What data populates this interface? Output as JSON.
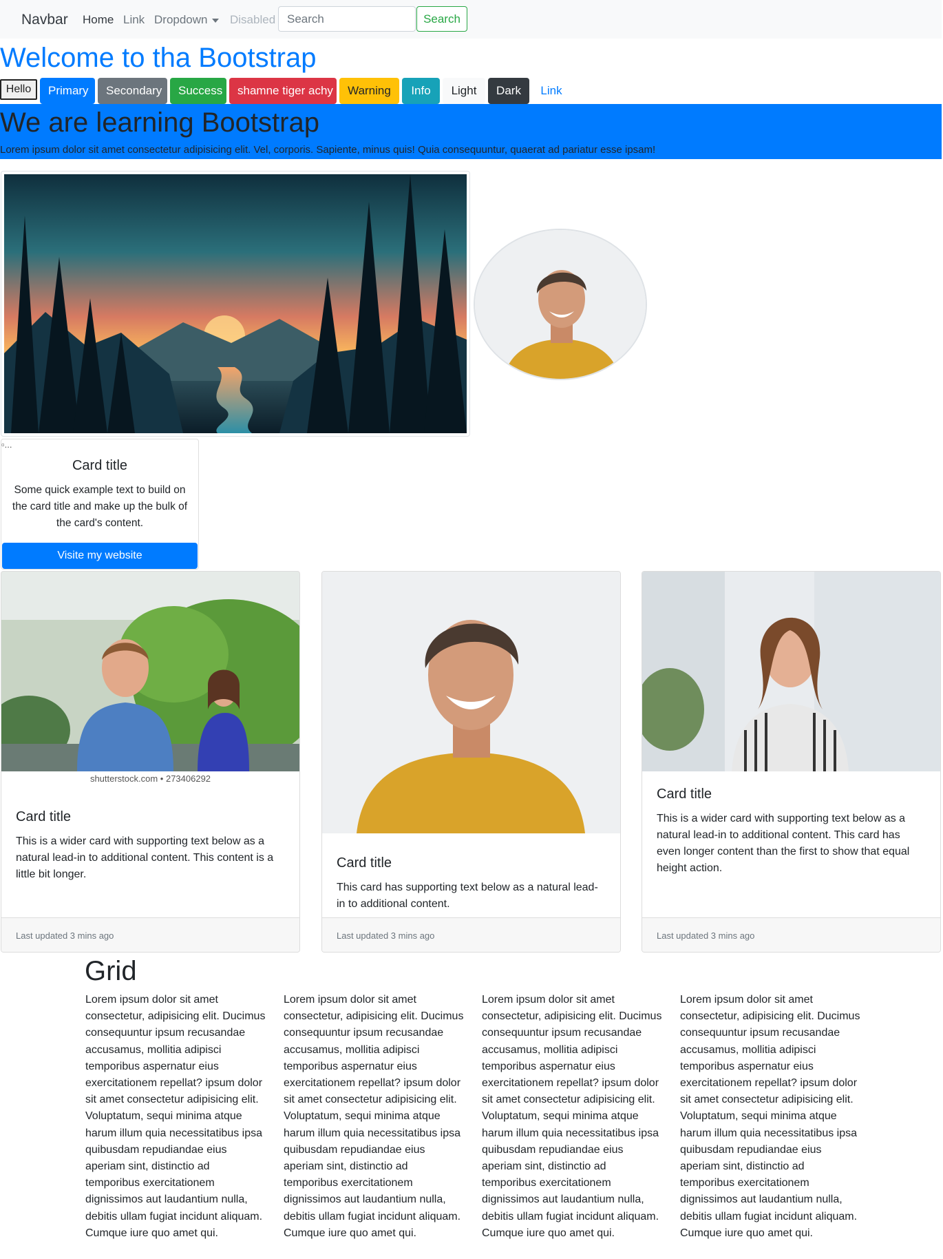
{
  "navbar": {
    "brand": "Navbar",
    "links": [
      "Home",
      "Link",
      "Dropdown",
      "Disabled"
    ],
    "search_placeholder": "Search",
    "search_button": "Search"
  },
  "welcome_heading": "Welcome to tha Bootstrap",
  "buttons": [
    "Hello",
    "Primary",
    "Secondary",
    "Success",
    "shamne tiger achy",
    "Warning",
    "Info",
    "Light",
    "Dark",
    "Link"
  ],
  "jumbotron": {
    "heading": "We are learning Bootstrap",
    "lead": "Lorem ipsum dolor sit amet consectetur adipisicing elit. Vel, corporis. Sapiente, minus quis! Quia consequuntur, quaerat ad pariatur esse ipsam!"
  },
  "small_card": {
    "img_alt": "...",
    "title": "Card title",
    "text": "Some quick example text to build on the card title and make up the bulk of the card's content.",
    "button": "Visite my website"
  },
  "cards": [
    {
      "title": "Card title",
      "watermark": "shutterstock.com • 273406292",
      "text": "This is a wider card with supporting text below as a natural lead-in to additional content. This content is a little bit longer.",
      "footer": "Last updated 3 mins ago"
    },
    {
      "title": "Card title",
      "text": "This card has supporting text below as a natural lead-in to additional content.",
      "footer": "Last updated 3 mins ago"
    },
    {
      "title": "Card title",
      "text": "This is a wider card with supporting text below as a natural lead-in to additional content. This card has even longer content than the first to show that equal height action.",
      "footer": "Last updated 3 mins ago"
    }
  ],
  "grid": {
    "title": "Grid",
    "columns": [
      "Lorem ipsum dolor sit amet consectetur, adipisicing elit. Ducimus consequuntur ipsum recusandae accusamus, mollitia adipisci temporibus aspernatur eius exercitationem repellat? ipsum dolor sit amet consectetur adipisicing elit. Voluptatum, sequi minima atque harum illum quia necessitatibus ipsa quibusdam repudiandae eius aperiam sint, distinctio ad temporibus exercitationem dignissimos aut laudantium nulla, debitis ullam fugiat incidunt aliquam. Cumque iure quo amet qui.",
      "Lorem ipsum dolor sit amet consectetur, adipisicing elit. Ducimus consequuntur ipsum recusandae accusamus, mollitia adipisci temporibus aspernatur eius exercitationem repellat? ipsum dolor sit amet consectetur adipisicing elit. Voluptatum, sequi minima atque harum illum quia necessitatibus ipsa quibusdam repudiandae eius aperiam sint, distinctio ad temporibus exercitationem dignissimos aut laudantium nulla, debitis ullam fugiat incidunt aliquam. Cumque iure quo amet qui.",
      "Lorem ipsum dolor sit amet consectetur, adipisicing elit. Ducimus consequuntur ipsum recusandae accusamus, mollitia adipisci temporibus aspernatur eius exercitationem repellat? ipsum dolor sit amet consectetur adipisicing elit. Voluptatum, sequi minima atque harum illum quia necessitatibus ipsa quibusdam repudiandae eius aperiam sint, distinctio ad temporibus exercitationem dignissimos aut laudantium nulla, debitis ullam fugiat incidunt aliquam. Cumque iure quo amet qui.",
      "Lorem ipsum dolor sit amet consectetur, adipisicing elit. Ducimus consequuntur ipsum recusandae accusamus, mollitia adipisci temporibus aspernatur eius exercitationem repellat? ipsum dolor sit amet consectetur adipisicing elit. Voluptatum, sequi minima atque harum illum quia necessitatibus ipsa quibusdam repudiandae eius aperiam sint, distinctio ad temporibus exercitationem dignissimos aut laudantium nulla, debitis ullam fugiat incidunt aliquam. Cumque iure quo amet qui."
    ]
  },
  "colors": {
    "primary": "#007bff",
    "secondary": "#6c757d",
    "success": "#28a745",
    "danger": "#dc3545",
    "warning": "#ffc107",
    "info": "#17a2b8",
    "light": "#f8f9fa",
    "dark": "#343a40"
  }
}
